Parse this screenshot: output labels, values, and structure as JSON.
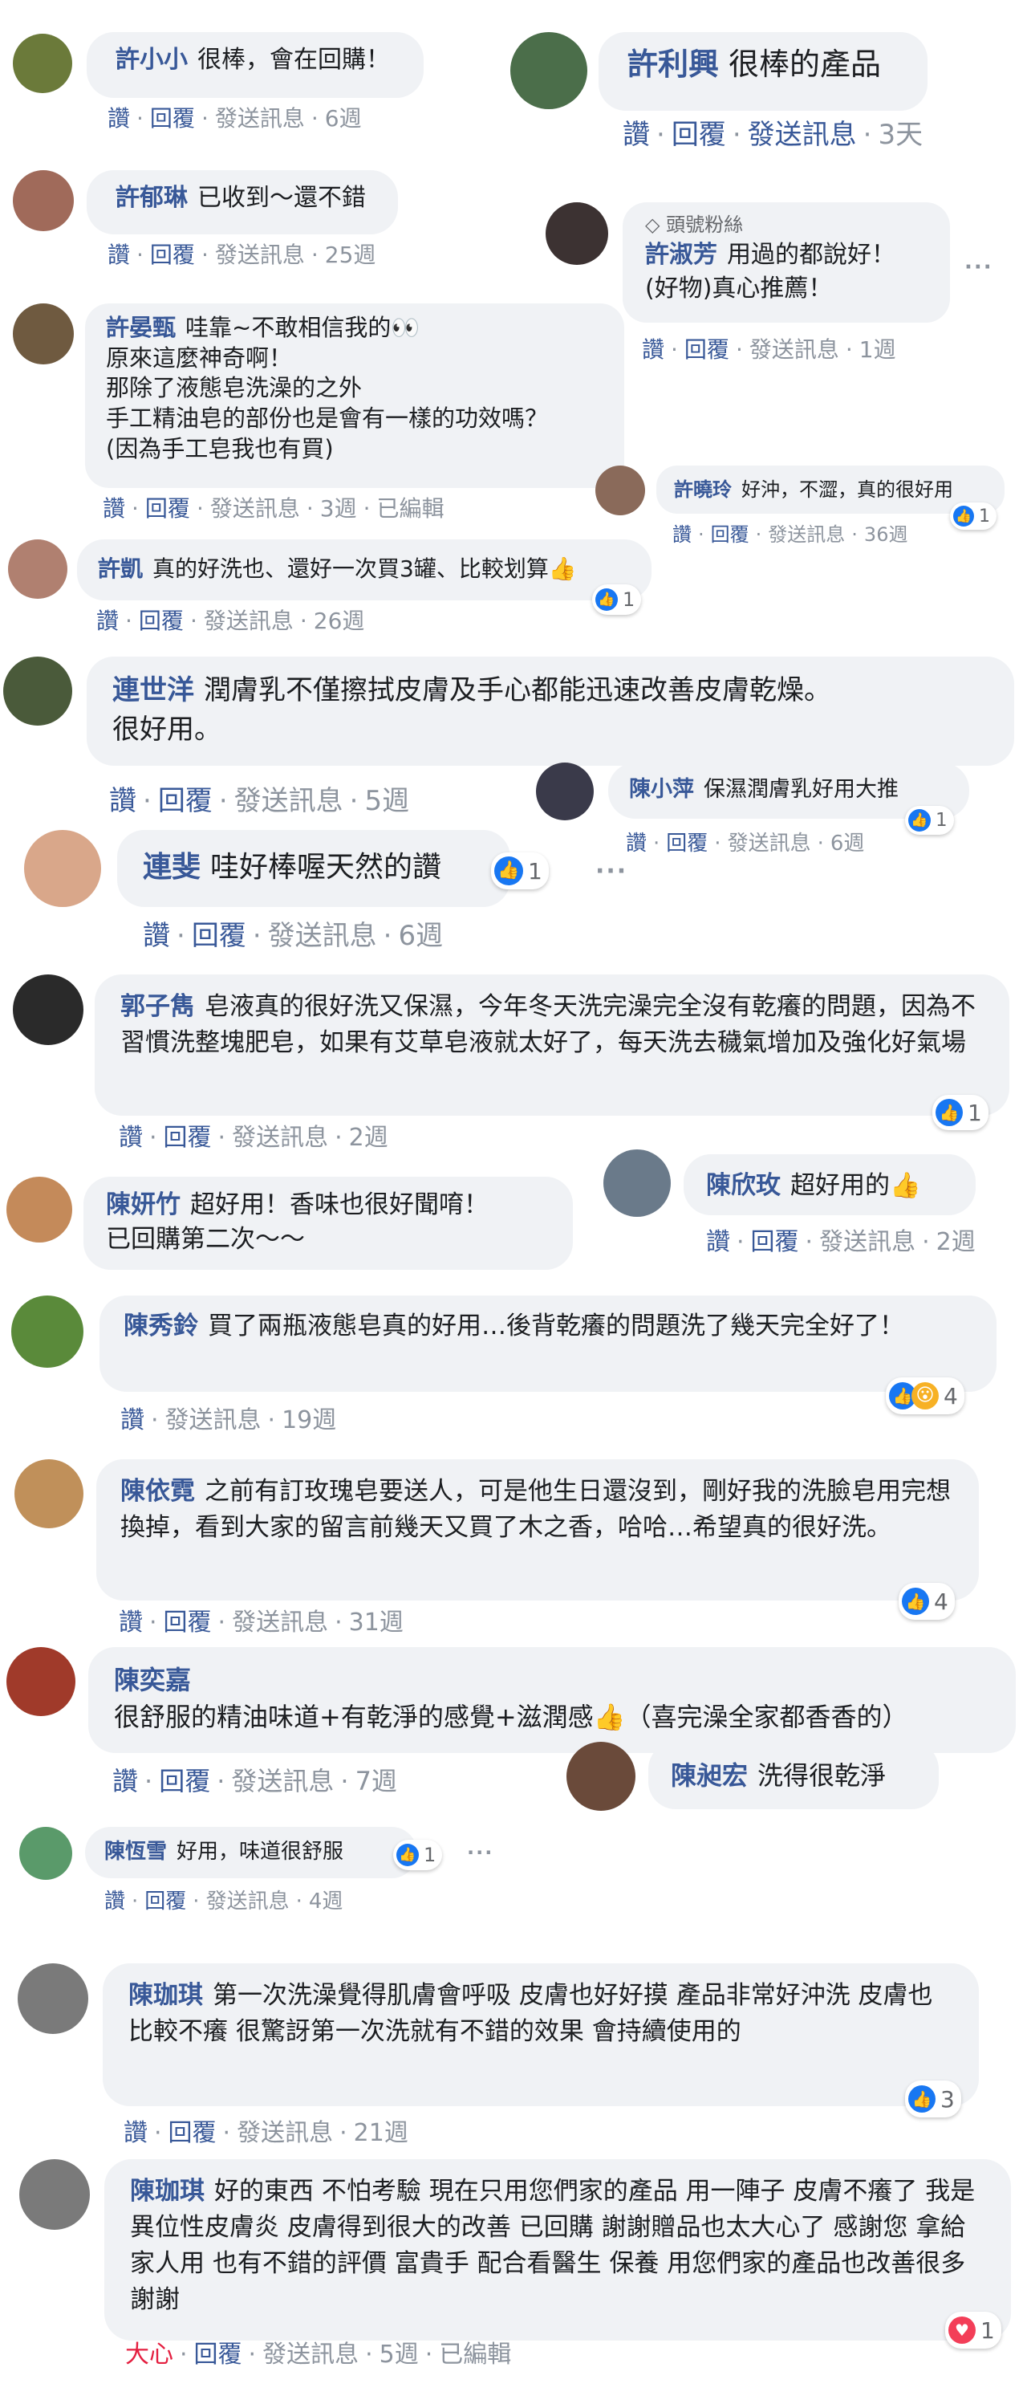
{
  "actions": {
    "like": "讚",
    "reply": "回覆",
    "message": "發送訊息",
    "love": "大心"
  },
  "badge_top_fan": "頭號粉絲",
  "more": "···",
  "comments": [
    {
      "name": "許小小",
      "text": "很棒，會在回購！",
      "time": "6週",
      "avatar": "#6b7a3a"
    },
    {
      "name": "許利興",
      "text": "很棒的產品",
      "time": "3天",
      "avatar": "#4b6e4a"
    },
    {
      "name": "許郁琳",
      "text": "已收到～還不錯",
      "time": "25週",
      "avatar": "#a06a5a"
    },
    {
      "name": "許淑芳",
      "text": "用過的都說好！\n(好物)真心推薦！",
      "time": "1週",
      "avatar": "#3c3232"
    },
    {
      "name": "許晏甄",
      "text": "哇靠~不敢相信我的👀\n原來這麼神奇啊！\n那除了液態皂洗澡的之外\n手工精油皂的部份也是會有一樣的功效嗎？\n(因為手工皂我也有買)",
      "time": "3週",
      "edited": "已編輯",
      "avatar": "#6f5a40"
    },
    {
      "name": "許曉玲",
      "text": "好沖，不澀，真的很好用",
      "time": "36週",
      "reactions": "1",
      "avatar": "#8a6a5a"
    },
    {
      "name": "許凱",
      "text": "真的好洗也、還好一次買3罐、比較划算👍",
      "time": "26週",
      "reactions": "1",
      "avatar": "#b08070"
    },
    {
      "name": "連世洋",
      "text": "潤膚乳不僅擦拭皮膚及手心都能迅速改善皮膚乾燥。\n很好用。",
      "time": "5週",
      "avatar": "#4a5a3a"
    },
    {
      "name": "陳小萍",
      "text": "保濕潤膚乳好用大推",
      "time": "6週",
      "reactions": "1",
      "avatar": "#3a3a4a"
    },
    {
      "name": "連斐",
      "text": "哇好棒喔天然的讚",
      "time": "6週",
      "reactions": "1",
      "avatar": "#d9a78a"
    },
    {
      "name": "郭子雋",
      "text": "皂液真的很好洗又保濕，今年冬天洗完澡完全沒有乾癢的問題，因為不習慣洗整塊肥皂，如果有艾草皂液就太好了，每天洗去穢氣增加及強化好氣場",
      "time": "2週",
      "reactions": "1",
      "avatar": "#2a2a2a"
    },
    {
      "name": "陳妍竹",
      "text": "超好用！香味也很好聞唷！\n已回購第二次～～",
      "time": "",
      "avatar": "#c48a5a"
    },
    {
      "name": "陳欣玫",
      "text": "超好用的👍",
      "time": "2週",
      "avatar": "#6a7a8a"
    },
    {
      "name": "陳秀鈴",
      "text": "買了兩瓶液態皂真的好用…後背乾癢的問題洗了幾天完全好了！",
      "time": "19週",
      "reactions": "4",
      "avatar": "#5a8a3a"
    },
    {
      "name": "陳依霓",
      "text": "之前有訂玫瑰皂要送人，可是他生日還沒到，剛好我的洗臉皂用完想換掉，看到大家的留言前幾天又買了木之香，哈哈…希望真的很好洗。",
      "time": "31週",
      "reactions": "4",
      "avatar": "#c0905a"
    },
    {
      "name": "陳奕嘉",
      "text": "很舒服的精油味道+有乾淨的感覺+滋潤感👍（喜完澡全家都香香的）",
      "time": "7週",
      "avatar": "#a03a2a"
    },
    {
      "name": "陳昶宏",
      "text": "洗得很乾淨",
      "time": "",
      "avatar": "#6a4a3a"
    },
    {
      "name": "陳恆雪",
      "text": "好用，味道很舒服",
      "time": "4週",
      "reactions": "1",
      "avatar": "#5a9a6a"
    },
    {
      "name": "陳珈琪",
      "text": "第一次洗澡覺得肌膚會呼吸 皮膚也好好摸 產品非常好沖洗 皮膚也比較不癢 很驚訝第一次洗就有不錯的效果 會持續使用的",
      "time": "21週",
      "reactions": "3",
      "avatar": "#7a7a7a"
    },
    {
      "name": "陳珈琪",
      "text": "好的東西 不怕考驗 現在只用您們家的產品 用一陣子 皮膚不癢了 我是異位性皮膚炎 皮膚得到很大的改善 已回購 謝謝贈品也太大心了 感謝您 拿給家人用 也有不錯的評價 富貴手 配合看醫生 保養 用您們家的產品也改善很多 謝謝",
      "time": "5週",
      "edited": "已編輯",
      "reactions": "1",
      "avatar": "#7a7a7a"
    }
  ]
}
